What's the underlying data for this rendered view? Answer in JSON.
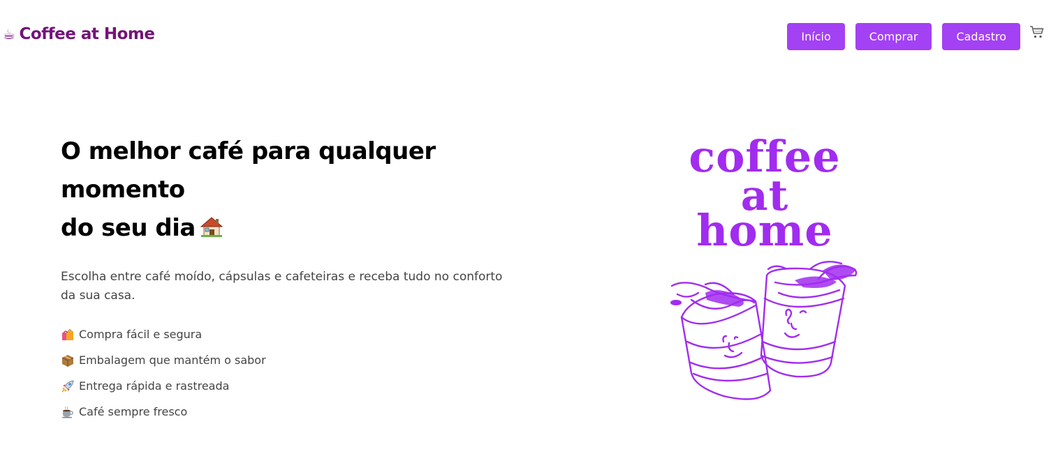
{
  "header": {
    "brand_icon": "coffee-cup-icon",
    "brand": "Coffee at Home",
    "nav": [
      {
        "label": "Início"
      },
      {
        "label": "Comprar"
      },
      {
        "label": "Cadastro"
      }
    ],
    "cart_icon": "shopping-cart-icon"
  },
  "hero": {
    "title_lines": [
      "O melhor café para qualquer",
      "momento",
      "do seu dia"
    ],
    "title_icon": "house-icon",
    "description": "Escolha entre café moído, cápsulas e cafeteiras e receba tudo no conforto da sua casa.",
    "features": [
      {
        "icon": "shopping-bags-icon",
        "text": "Compra fácil e segura"
      },
      {
        "icon": "package-icon",
        "text": "Embalagem que mantém o sabor"
      },
      {
        "icon": "rocket-icon",
        "text": "Entrega rápida e rastreada"
      },
      {
        "icon": "coffee-cup-icon",
        "text": "Café sempre fresco"
      }
    ]
  },
  "illustration": {
    "words": [
      "coffee",
      "at",
      "home"
    ]
  },
  "colors": {
    "brand": "#74137a",
    "accent": "#a341f4",
    "illustration": "#a12cf0"
  }
}
